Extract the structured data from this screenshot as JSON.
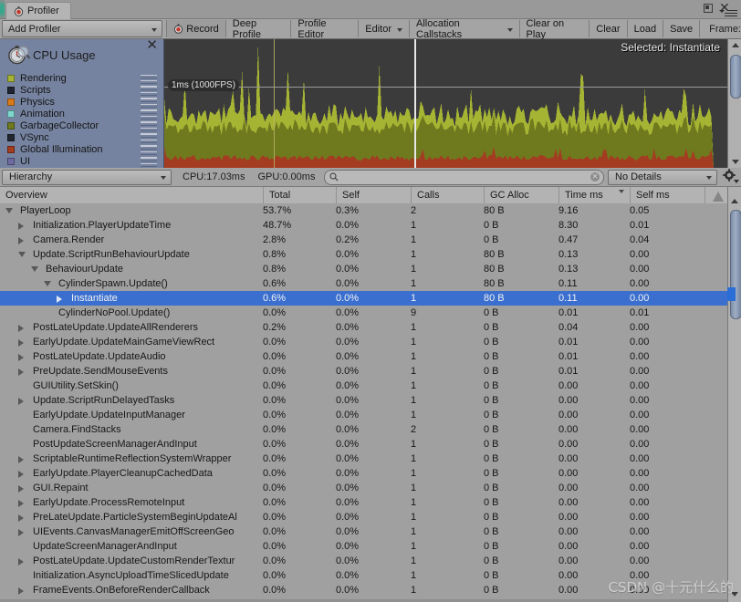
{
  "window": {
    "tab_label": "Profiler",
    "tab_icon": "stopwatch-icon",
    "minimize_icon": "restore-icon",
    "close_icon": "close-icon",
    "menu_icon": "hamburger-menu-icon"
  },
  "toolbar": {
    "add_profiler": "Add Profiler",
    "buttons": [
      {
        "label": "Record",
        "icon": "record-dot-icon",
        "has_caret": false
      },
      {
        "label": "Deep Profile",
        "icon": null,
        "has_caret": false
      },
      {
        "label": "Profile Editor",
        "icon": null,
        "has_caret": false
      },
      {
        "label": "Editor",
        "icon": null,
        "has_caret": true
      },
      {
        "label": "Allocation Callstacks",
        "icon": null,
        "has_caret": true
      },
      {
        "label": "Clear on Play",
        "icon": null,
        "has_caret": false
      },
      {
        "label": "Clear",
        "icon": null,
        "has_caret": false
      },
      {
        "label": "Load",
        "icon": null,
        "has_caret": false
      },
      {
        "label": "Save",
        "icon": null,
        "has_caret": false
      }
    ],
    "frame_label": "Frame:"
  },
  "chart": {
    "title": "CPU Usage",
    "title_icon": "stopwatch-magnifier-icon",
    "close_icon": "close-icon",
    "selected_label": "Selected: Instantiate",
    "ms_marker": "1ms (1000FPS)",
    "legend": [
      {
        "name": "Rendering",
        "color": "#a6b434"
      },
      {
        "name": "Scripts",
        "color": "#1f2430"
      },
      {
        "name": "Physics",
        "color": "#d97a1b"
      },
      {
        "name": "Animation",
        "color": "#7fd7cd"
      },
      {
        "name": "GarbageCollector",
        "color": "#6f7a1e"
      },
      {
        "name": "VSync",
        "color": "#22262f"
      },
      {
        "name": "Global Illumination",
        "color": "#a43c21"
      },
      {
        "name": "UI",
        "color": "#6e6ba0"
      }
    ]
  },
  "subtoolbar": {
    "view_mode": "Hierarchy",
    "cpu_stat": "CPU:17.03ms",
    "gpu_stat": "GPU:0.00ms",
    "search_value": "",
    "search_placeholder": "",
    "search_icon": "search-icon",
    "clear_search_icon": "clear-icon",
    "details_mode": "No Details",
    "settings_icon": "gear-icon"
  },
  "table": {
    "columns": [
      {
        "key": "name",
        "label": "Overview"
      },
      {
        "key": "total",
        "label": "Total"
      },
      {
        "key": "self",
        "label": "Self"
      },
      {
        "key": "calls",
        "label": "Calls"
      },
      {
        "key": "gc",
        "label": "GC Alloc"
      },
      {
        "key": "time",
        "label": "Time ms",
        "sorted": true
      },
      {
        "key": "selfms",
        "label": "Self ms"
      },
      {
        "key": "warn",
        "label": ""
      }
    ],
    "rows": [
      {
        "name": "PlayerLoop",
        "depth": 0,
        "toggle": "open",
        "total": "53.7%",
        "self": "0.3%",
        "calls": "2",
        "gc": "80 B",
        "time": "9.16",
        "selfms": "0.05",
        "selected": false
      },
      {
        "name": "Initialization.PlayerUpdateTime",
        "depth": 1,
        "toggle": "closed",
        "total": "48.7%",
        "self": "0.0%",
        "calls": "1",
        "gc": "0 B",
        "time": "8.30",
        "selfms": "0.01",
        "selected": false
      },
      {
        "name": "Camera.Render",
        "depth": 1,
        "toggle": "closed",
        "total": "2.8%",
        "self": "0.2%",
        "calls": "1",
        "gc": "0 B",
        "time": "0.47",
        "selfms": "0.04",
        "selected": false
      },
      {
        "name": "Update.ScriptRunBehaviourUpdate",
        "depth": 1,
        "toggle": "open",
        "total": "0.8%",
        "self": "0.0%",
        "calls": "1",
        "gc": "80 B",
        "time": "0.13",
        "selfms": "0.00",
        "selected": false
      },
      {
        "name": "BehaviourUpdate",
        "depth": 2,
        "toggle": "open",
        "total": "0.8%",
        "self": "0.0%",
        "calls": "1",
        "gc": "80 B",
        "time": "0.13",
        "selfms": "0.00",
        "selected": false
      },
      {
        "name": "CylinderSpawn.Update()",
        "depth": 3,
        "toggle": "open",
        "total": "0.6%",
        "self": "0.0%",
        "calls": "1",
        "gc": "80 B",
        "time": "0.11",
        "selfms": "0.00",
        "selected": false
      },
      {
        "name": "Instantiate",
        "depth": 4,
        "toggle": "closed",
        "total": "0.6%",
        "self": "0.0%",
        "calls": "1",
        "gc": "80 B",
        "time": "0.11",
        "selfms": "0.00",
        "selected": true
      },
      {
        "name": "CylinderNoPool.Update()",
        "depth": 3,
        "toggle": "none",
        "total": "0.0%",
        "self": "0.0%",
        "calls": "9",
        "gc": "0 B",
        "time": "0.01",
        "selfms": "0.01",
        "selected": false
      },
      {
        "name": "PostLateUpdate.UpdateAllRenderers",
        "depth": 1,
        "toggle": "closed",
        "total": "0.2%",
        "self": "0.0%",
        "calls": "1",
        "gc": "0 B",
        "time": "0.04",
        "selfms": "0.00",
        "selected": false
      },
      {
        "name": "EarlyUpdate.UpdateMainGameViewRect",
        "depth": 1,
        "toggle": "closed",
        "total": "0.0%",
        "self": "0.0%",
        "calls": "1",
        "gc": "0 B",
        "time": "0.01",
        "selfms": "0.00",
        "selected": false
      },
      {
        "name": "PostLateUpdate.UpdateAudio",
        "depth": 1,
        "toggle": "closed",
        "total": "0.0%",
        "self": "0.0%",
        "calls": "1",
        "gc": "0 B",
        "time": "0.01",
        "selfms": "0.00",
        "selected": false
      },
      {
        "name": "PreUpdate.SendMouseEvents",
        "depth": 1,
        "toggle": "closed",
        "total": "0.0%",
        "self": "0.0%",
        "calls": "1",
        "gc": "0 B",
        "time": "0.01",
        "selfms": "0.00",
        "selected": false
      },
      {
        "name": "GUIUtility.SetSkin()",
        "depth": 1,
        "toggle": "none",
        "total": "0.0%",
        "self": "0.0%",
        "calls": "1",
        "gc": "0 B",
        "time": "0.00",
        "selfms": "0.00",
        "selected": false
      },
      {
        "name": "Update.ScriptRunDelayedTasks",
        "depth": 1,
        "toggle": "closed",
        "total": "0.0%",
        "self": "0.0%",
        "calls": "1",
        "gc": "0 B",
        "time": "0.00",
        "selfms": "0.00",
        "selected": false
      },
      {
        "name": "EarlyUpdate.UpdateInputManager",
        "depth": 1,
        "toggle": "none",
        "total": "0.0%",
        "self": "0.0%",
        "calls": "1",
        "gc": "0 B",
        "time": "0.00",
        "selfms": "0.00",
        "selected": false
      },
      {
        "name": "Camera.FindStacks",
        "depth": 1,
        "toggle": "none",
        "total": "0.0%",
        "self": "0.0%",
        "calls": "2",
        "gc": "0 B",
        "time": "0.00",
        "selfms": "0.00",
        "selected": false
      },
      {
        "name": "PostUpdateScreenManagerAndInput",
        "depth": 1,
        "toggle": "none",
        "total": "0.0%",
        "self": "0.0%",
        "calls": "1",
        "gc": "0 B",
        "time": "0.00",
        "selfms": "0.00",
        "selected": false
      },
      {
        "name": "ScriptableRuntimeReflectionSystemWrapper",
        "depth": 1,
        "toggle": "closed",
        "total": "0.0%",
        "self": "0.0%",
        "calls": "1",
        "gc": "0 B",
        "time": "0.00",
        "selfms": "0.00",
        "selected": false
      },
      {
        "name": "EarlyUpdate.PlayerCleanupCachedData",
        "depth": 1,
        "toggle": "closed",
        "total": "0.0%",
        "self": "0.0%",
        "calls": "1",
        "gc": "0 B",
        "time": "0.00",
        "selfms": "0.00",
        "selected": false
      },
      {
        "name": "GUI.Repaint",
        "depth": 1,
        "toggle": "closed",
        "total": "0.0%",
        "self": "0.0%",
        "calls": "1",
        "gc": "0 B",
        "time": "0.00",
        "selfms": "0.00",
        "selected": false
      },
      {
        "name": "EarlyUpdate.ProcessRemoteInput",
        "depth": 1,
        "toggle": "closed",
        "total": "0.0%",
        "self": "0.0%",
        "calls": "1",
        "gc": "0 B",
        "time": "0.00",
        "selfms": "0.00",
        "selected": false
      },
      {
        "name": "PreLateUpdate.ParticleSystemBeginUpdateAl",
        "depth": 1,
        "toggle": "closed",
        "total": "0.0%",
        "self": "0.0%",
        "calls": "1",
        "gc": "0 B",
        "time": "0.00",
        "selfms": "0.00",
        "selected": false
      },
      {
        "name": "UIEvents.CanvasManagerEmitOffScreenGeo",
        "depth": 1,
        "toggle": "closed",
        "total": "0.0%",
        "self": "0.0%",
        "calls": "1",
        "gc": "0 B",
        "time": "0.00",
        "selfms": "0.00",
        "selected": false
      },
      {
        "name": "UpdateScreenManagerAndInput",
        "depth": 1,
        "toggle": "none",
        "total": "0.0%",
        "self": "0.0%",
        "calls": "1",
        "gc": "0 B",
        "time": "0.00",
        "selfms": "0.00",
        "selected": false
      },
      {
        "name": "PostLateUpdate.UpdateCustomRenderTextur",
        "depth": 1,
        "toggle": "closed",
        "total": "0.0%",
        "self": "0.0%",
        "calls": "1",
        "gc": "0 B",
        "time": "0.00",
        "selfms": "0.00",
        "selected": false
      },
      {
        "name": "Initialization.AsyncUploadTimeSlicedUpdate",
        "depth": 1,
        "toggle": "none",
        "total": "0.0%",
        "self": "0.0%",
        "calls": "1",
        "gc": "0 B",
        "time": "0.00",
        "selfms": "0.00",
        "selected": false
      },
      {
        "name": "FrameEvents.OnBeforeRenderCallback",
        "depth": 1,
        "toggle": "closed",
        "total": "0.0%",
        "self": "0.0%",
        "calls": "1",
        "gc": "0 B",
        "time": "0.00",
        "selfms": "0.00",
        "selected": false
      }
    ]
  },
  "watermark": "CSDN @十元什么的",
  "colors": {
    "selection": "#3a6fd0",
    "panel": "#a0a0a0",
    "toolbar": "#a4a4a4",
    "chart_bg": "#3b3b3b",
    "legend_bg": "#7683a0"
  }
}
